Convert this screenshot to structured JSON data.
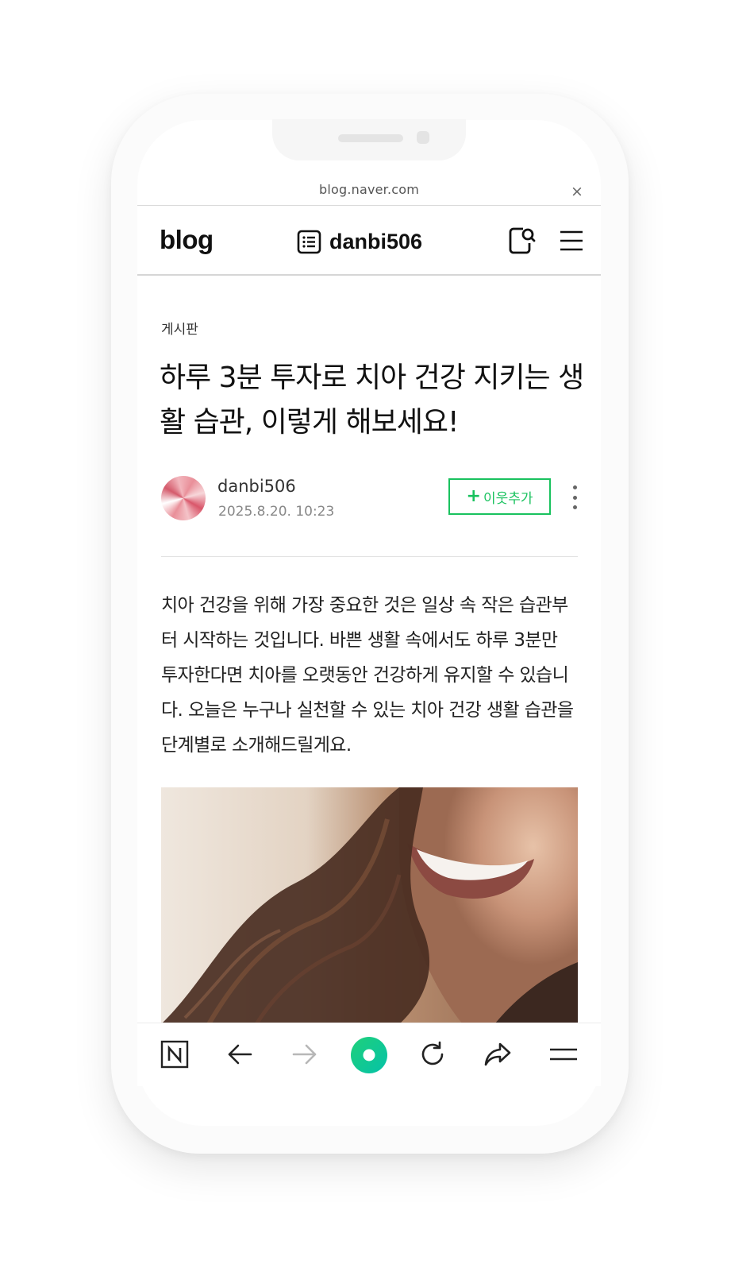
{
  "browser": {
    "url": "blog.naver.com",
    "close_label": "×"
  },
  "header": {
    "logo": "blog",
    "blog_name": "danbi506",
    "icons": [
      "list-icon",
      "search-chat-icon",
      "menu-icon"
    ]
  },
  "post": {
    "category": "게시판",
    "title": "하루 3분 투자로 치아 건강 지키는 생활 습관, 이렇게 해보세요!",
    "author": "danbi506",
    "date": "2025.8.20. 10:23",
    "add_neighbor_label": "이웃추가",
    "add_neighbor_plus": "+",
    "body": "치아 건강을 위해 가장 중요한 것은 일상 속 작은 습관부터 시작하는 것입니다. 바쁜 생활 속에서도 하루 3분만 투자한다면 치아를 오랫동안 건강하게 유지할 수 있습니다. 오늘은 누구나 실천할 수 있는 치아 건강 생활 습관을 단계별로 소개해드릴게요."
  },
  "bottom_nav": {
    "items": [
      "naver-home-icon",
      "back-icon",
      "forward-icon",
      "green-dot-icon",
      "refresh-icon",
      "share-icon",
      "menu-icon"
    ],
    "accent_color": "#19c25e"
  },
  "colors": {
    "accent": "#19c25e",
    "text": "#111111",
    "muted": "#888888"
  }
}
